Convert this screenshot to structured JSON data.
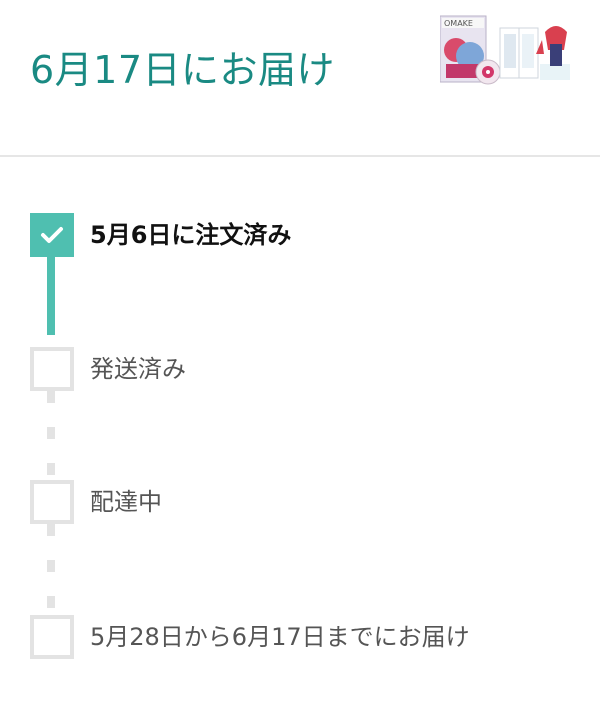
{
  "header": {
    "delivery_title": "6月17日にお届け"
  },
  "product": {
    "image_alt": "product-image",
    "cover_text": "OMAKE"
  },
  "steps": [
    {
      "label": "5月6日に注文済み",
      "status": "done"
    },
    {
      "label": "発送済み",
      "status": "pending"
    },
    {
      "label": "配達中",
      "status": "pending"
    },
    {
      "label": "5月28日から6月17日までにお届け",
      "status": "pending"
    }
  ],
  "colors": {
    "accent": "#1a8a83",
    "progress": "#4fbfb0",
    "inactive": "#e3e3e3"
  }
}
